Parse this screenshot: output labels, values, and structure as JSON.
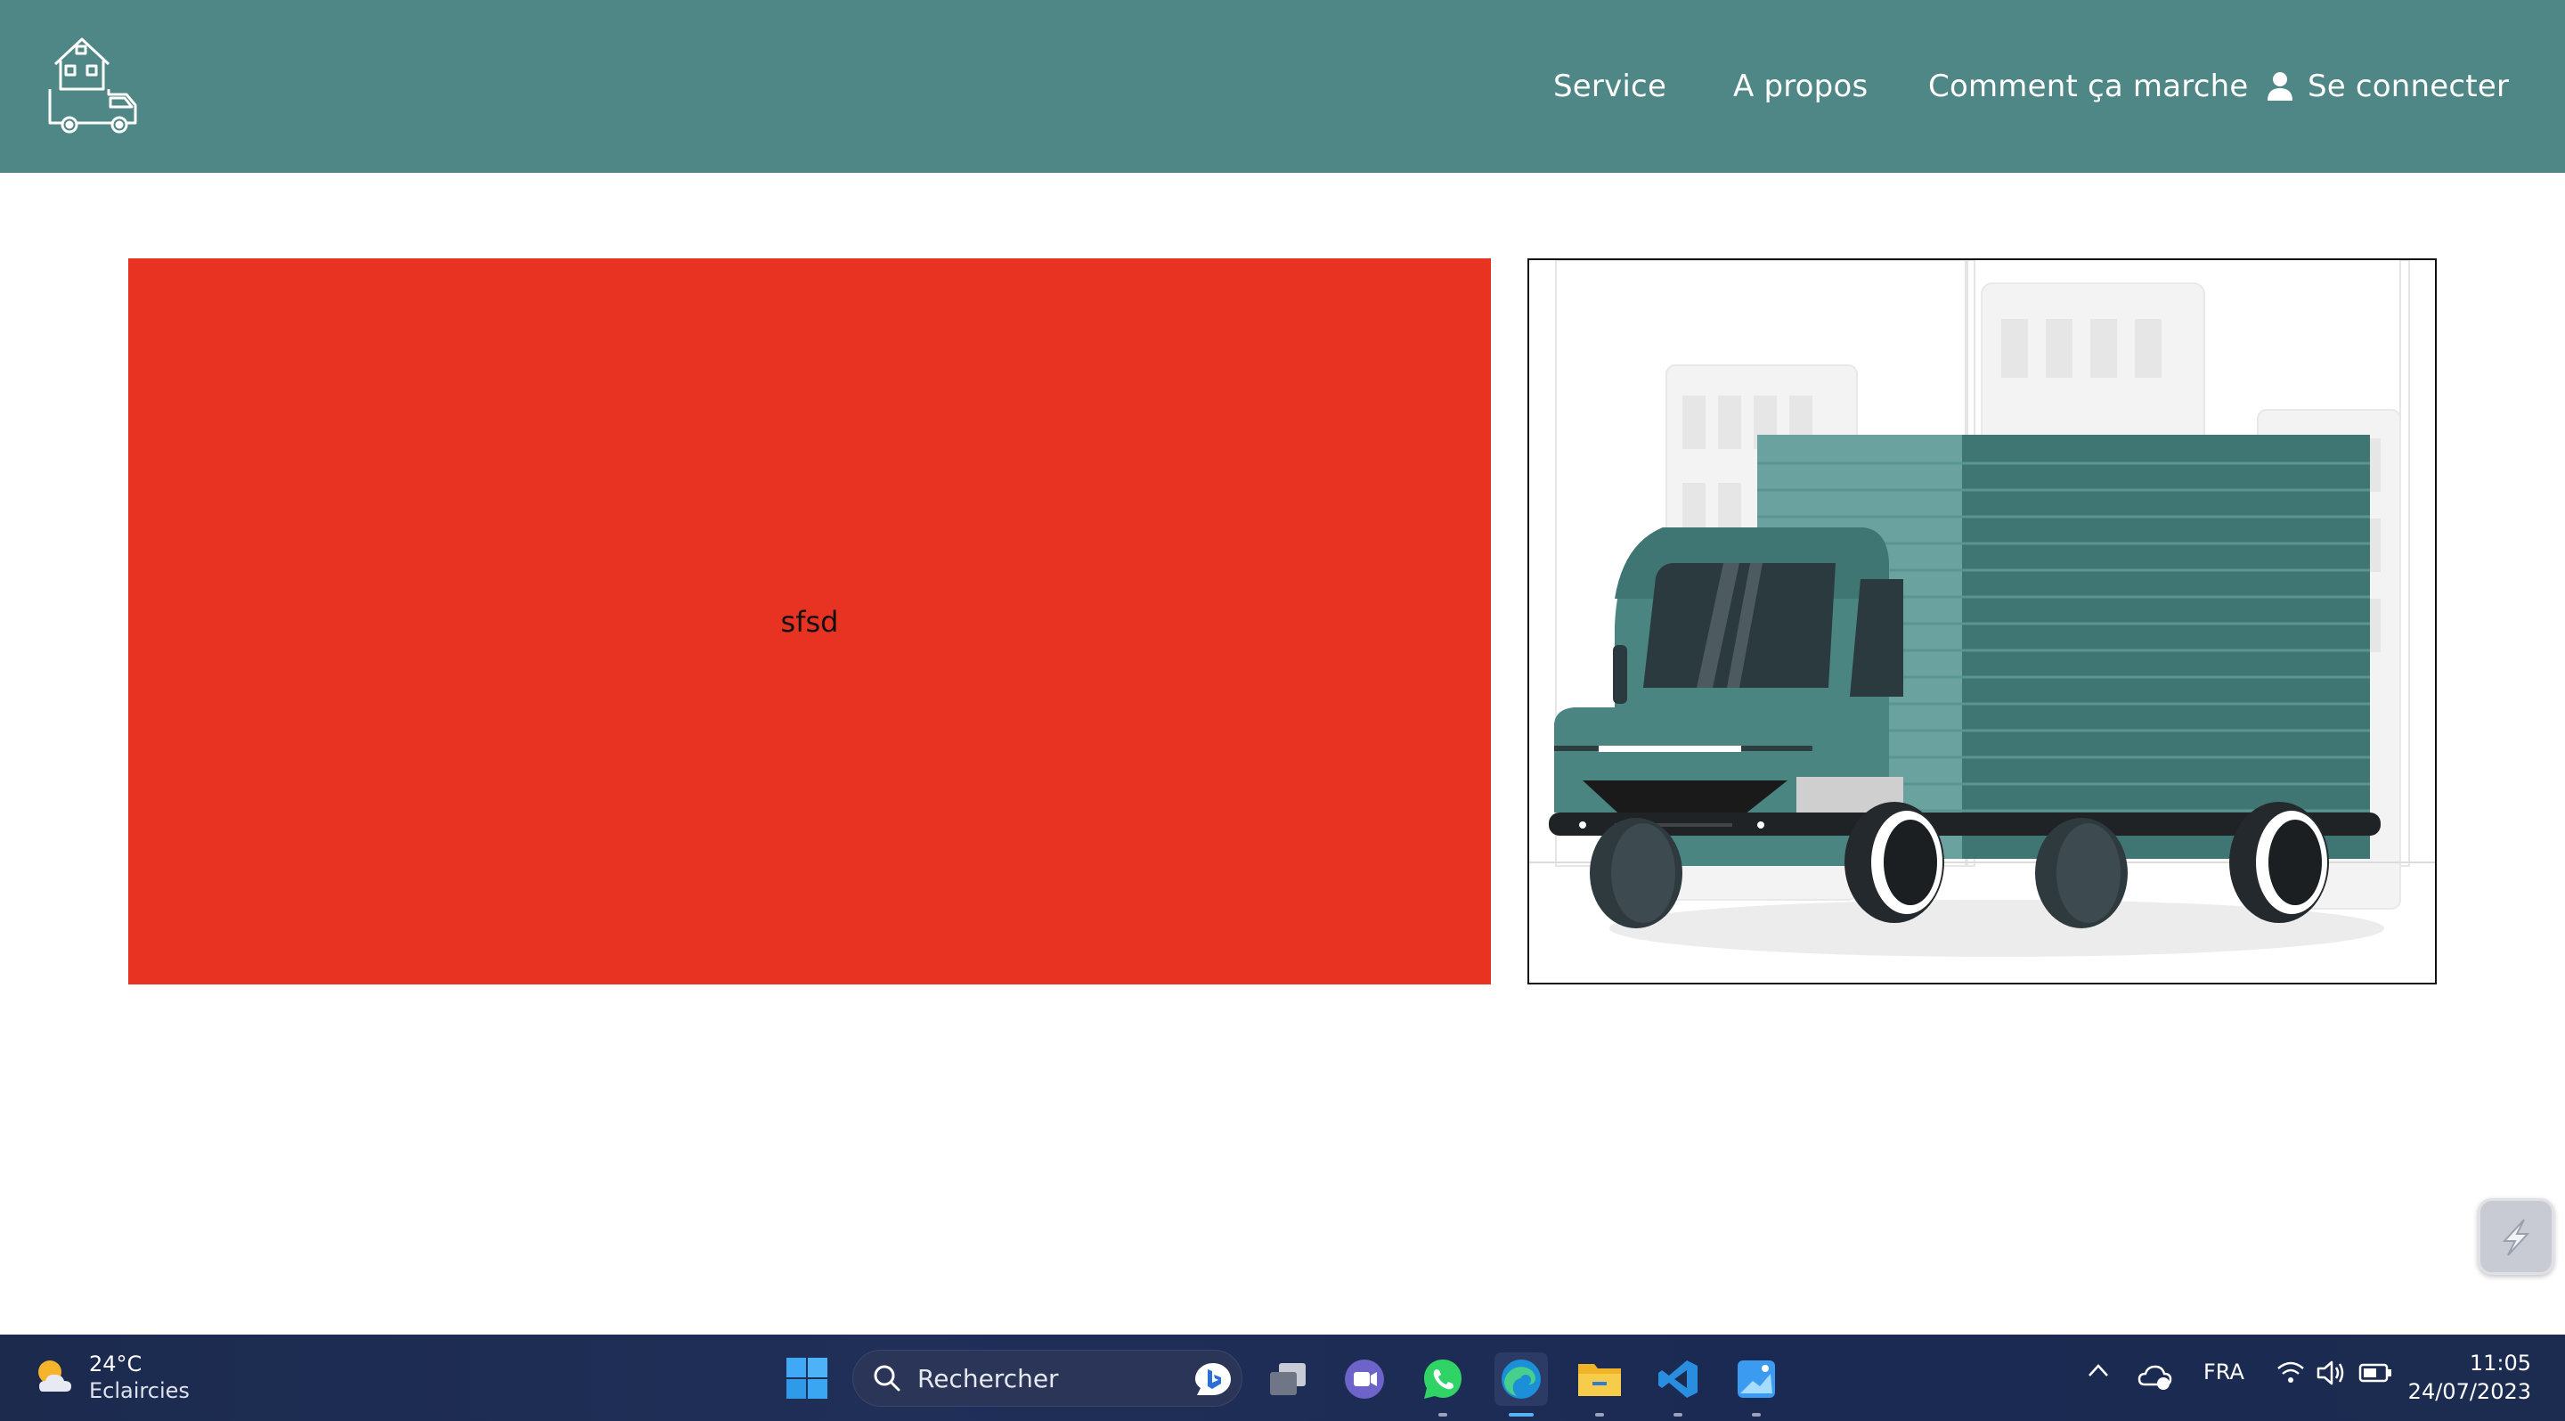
{
  "nav": {
    "items": [
      {
        "label": "Service"
      },
      {
        "label": "A propos"
      },
      {
        "label": "Comment ça marche"
      }
    ],
    "login_label": "Se connecter",
    "logo_icon": "house-truck-icon",
    "user_icon": "user-icon"
  },
  "main": {
    "panel_text": "sfsd",
    "panel_color": "#e83323",
    "illustration": "delivery-truck-illustration"
  },
  "colors": {
    "header": "#4e8785",
    "truck_teal": "#4a8582"
  },
  "taskbar": {
    "weather": {
      "temp": "24°C",
      "desc": "Eclaircies",
      "icon": "partly-sunny-icon"
    },
    "search_placeholder": "Rechercher",
    "apps": [
      "windows-start-icon",
      "task-view-icon",
      "teams-chat-icon",
      "whatsapp-icon",
      "edge-icon",
      "file-explorer-icon",
      "vscode-icon",
      "photos-icon"
    ],
    "language": "FRA",
    "time": "11:05",
    "date": "24/07/2023"
  }
}
